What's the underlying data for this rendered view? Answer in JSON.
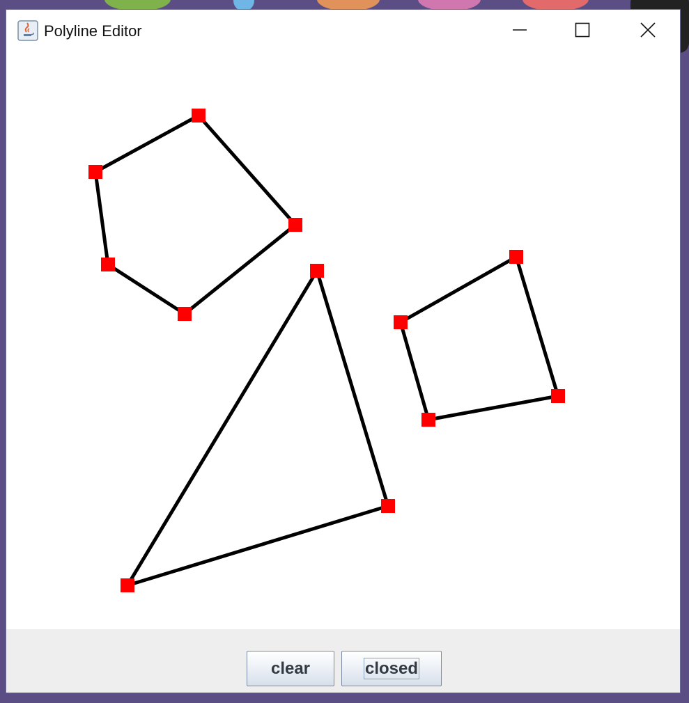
{
  "window": {
    "title": "Polyline Editor"
  },
  "titlebar_icons": {
    "app": "java-coffee-cup-icon",
    "minimize": "minimize-icon",
    "maximize": "maximize-icon",
    "close": "close-icon"
  },
  "buttons": {
    "clear": "clear",
    "closed": "closed"
  },
  "colors": {
    "vertex": "#ff0000",
    "edge": "#000000",
    "canvas": "#ffffff",
    "button_bar": "#eeeeee"
  }
}
